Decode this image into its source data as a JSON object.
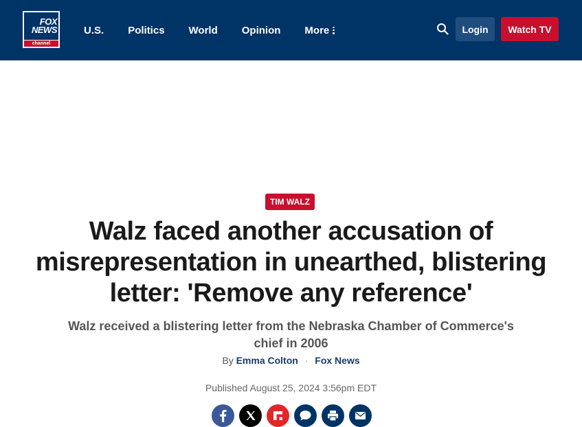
{
  "header": {
    "logo": {
      "line1": "FOX",
      "line2": "NEWS",
      "line3": "channel"
    },
    "nav": [
      {
        "label": "U.S."
      },
      {
        "label": "Politics"
      },
      {
        "label": "World"
      },
      {
        "label": "Opinion"
      },
      {
        "label": "More"
      }
    ],
    "login_label": "Login",
    "watch_label": "Watch TV",
    "colors": {
      "bg": "#003366",
      "accent": "#c8102e"
    }
  },
  "article": {
    "tag": "TIM WALZ",
    "headline": "Walz faced another accusation of misrepresentation in unearthed, blistering letter: 'Remove any reference'",
    "subhead": "Walz received a blistering letter from the Nebraska Chamber of Commerce's chief in 2006",
    "byline": {
      "prefix": "By",
      "author": "Emma Colton",
      "separator": "·",
      "source": "Fox News"
    },
    "published": "Published August 25, 2024 3:56pm EDT"
  },
  "share": [
    {
      "icon": "facebook-icon",
      "color": "#3b5998"
    },
    {
      "icon": "x-icon",
      "color": "#000000"
    },
    {
      "icon": "flipboard-icon",
      "color": "#e12828"
    },
    {
      "icon": "comment-icon",
      "color": "#003366"
    },
    {
      "icon": "print-icon",
      "color": "#003366"
    },
    {
      "icon": "email-icon",
      "color": "#003366"
    }
  ]
}
